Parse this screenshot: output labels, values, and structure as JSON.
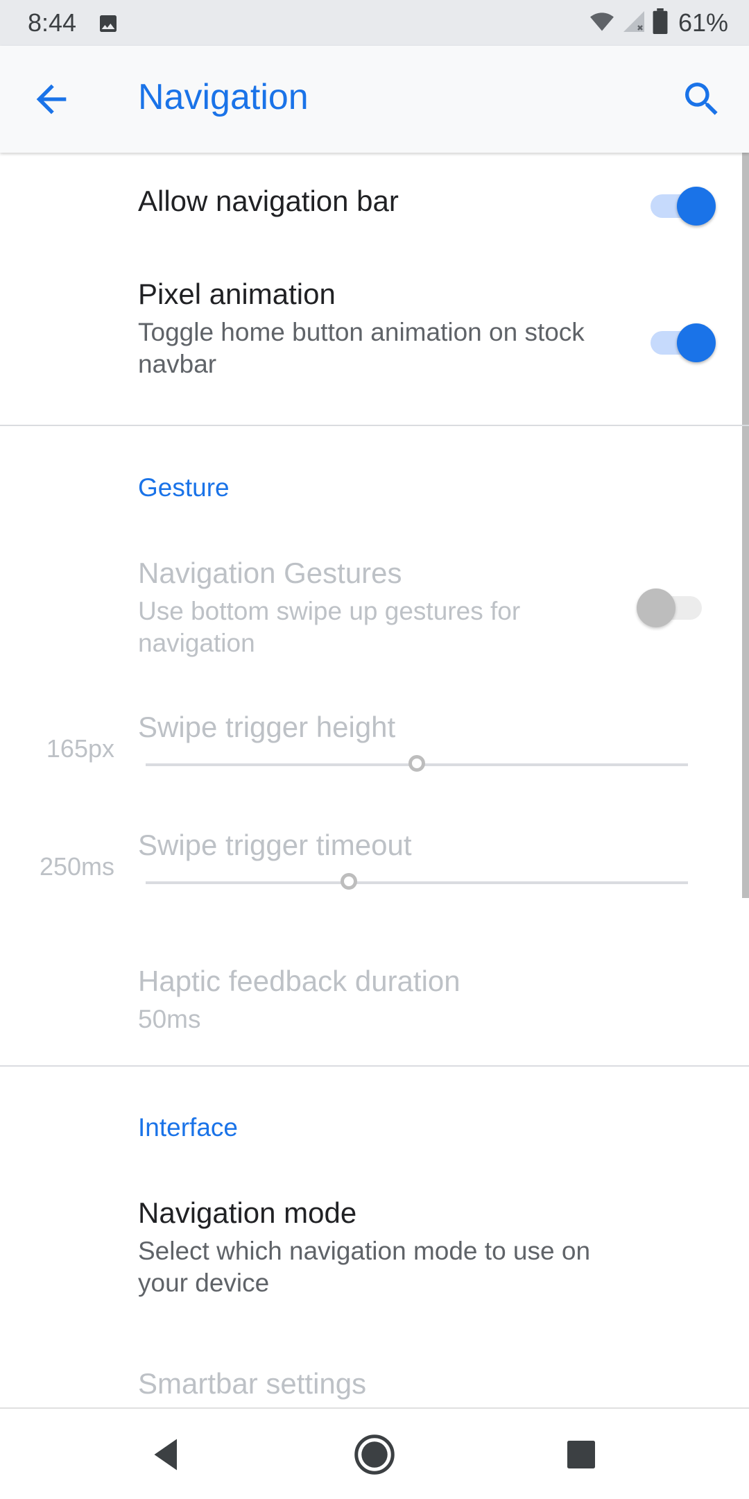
{
  "status_bar": {
    "time": "8:44",
    "battery_percent": "61%",
    "icons": [
      "photo-icon",
      "wifi-icon",
      "cell-signal-icon",
      "battery-icon"
    ]
  },
  "app_bar": {
    "title": "Navigation",
    "icons": [
      "back-arrow-icon",
      "search-icon"
    ],
    "accent_color": "#1a73e8"
  },
  "settings": {
    "allow_navbar": {
      "title": "Allow navigation bar",
      "enabled": true
    },
    "pixel_animation": {
      "title": "Pixel animation",
      "summary": "Toggle home button animation on stock navbar",
      "enabled": true
    },
    "gesture": {
      "header": "Gesture",
      "navigation_gestures": {
        "title": "Navigation Gestures",
        "summary": "Use bottom swipe up gestures for navigation",
        "enabled": false
      },
      "swipe_height": {
        "title": "Swipe trigger height",
        "value": "165px",
        "fraction": 0.5
      },
      "swipe_timeout": {
        "title": "Swipe trigger timeout",
        "value": "250ms",
        "fraction": 0.375
      },
      "haptic": {
        "title": "Haptic feedback duration",
        "summary": "50ms"
      }
    },
    "interface": {
      "header": "Interface",
      "navigation_mode": {
        "title": "Navigation mode",
        "summary": "Select which navigation mode to use on your device"
      },
      "smartbar": {
        "title": "Smartbar settings"
      }
    }
  },
  "nav_bar": {
    "icons": [
      "back-triangle-icon",
      "home-circle-icon",
      "recents-square-icon"
    ]
  }
}
